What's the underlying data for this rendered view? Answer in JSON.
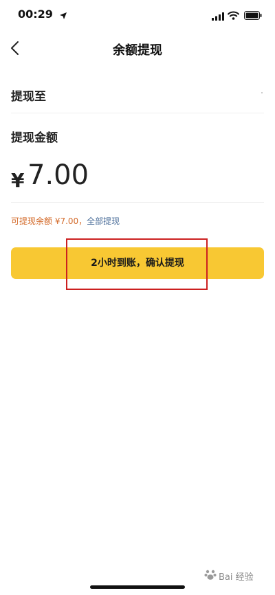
{
  "status_bar": {
    "time": "00:29",
    "icons": [
      "location-arrow-icon",
      "signal-icon",
      "wifi-icon",
      "battery-icon"
    ]
  },
  "nav": {
    "back_icon": "chevron-left-icon",
    "title": "余额提现"
  },
  "withdraw_to": {
    "label": "提现至"
  },
  "amount": {
    "label": "提现金额",
    "currency_symbol": "¥",
    "value": "7.00"
  },
  "balance": {
    "text": "可提现余额 ¥7.00，",
    "withdraw_all": "全部提现"
  },
  "confirm_button": {
    "label": "2小时到账，确认提现"
  },
  "watermark": {
    "text": "Bai 经验"
  },
  "colors": {
    "button": "#f8c833",
    "balance_text": "#d36a2a",
    "link": "#4a6d99",
    "highlight_box": "#cc2020"
  }
}
